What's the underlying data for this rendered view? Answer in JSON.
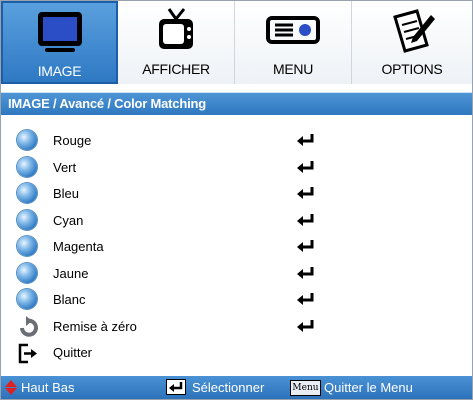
{
  "tabs": [
    {
      "label": "IMAGE",
      "icon": "monitor-icon",
      "active": true
    },
    {
      "label": "AFFICHER",
      "icon": "tv-icon",
      "active": false
    },
    {
      "label": "MENU",
      "icon": "projector-icon",
      "active": false
    },
    {
      "label": "OPTIONS",
      "icon": "notepad-pen-icon",
      "active": false
    }
  ],
  "header": {
    "title": "IMAGE / Avancé / Color Matching"
  },
  "items": [
    {
      "label": "Rouge"
    },
    {
      "label": "Vert"
    },
    {
      "label": "Bleu"
    },
    {
      "label": "Cyan"
    },
    {
      "label": "Magenta"
    },
    {
      "label": "Jaune"
    },
    {
      "label": "Blanc"
    },
    {
      "label": "Remise à zéro"
    },
    {
      "label": "Quitter"
    }
  ],
  "footer": {
    "nav_label": "Haut Bas",
    "select_label": "Sélectionner",
    "menu_key": "Menu",
    "exit_label": "Quitter le Menu"
  },
  "colors": {
    "accent": "#2f79c4",
    "header": "#3f88cf",
    "footer": "#3a82c8",
    "up_down_arrows": "#e02020"
  }
}
